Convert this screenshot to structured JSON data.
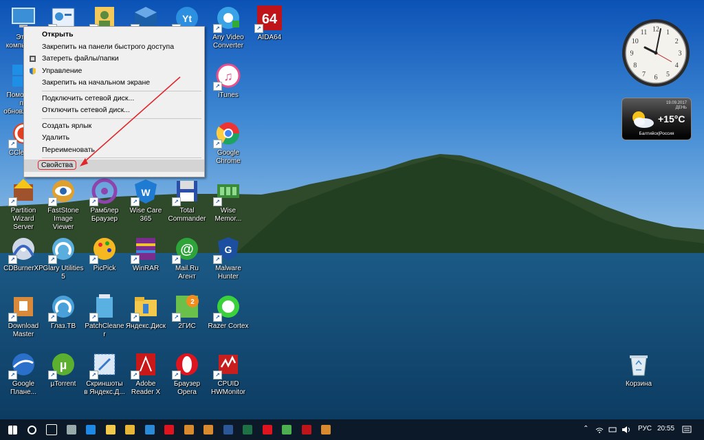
{
  "desktop_icons": [
    {
      "label": "Этот компьютер",
      "kind": "pc"
    },
    {
      "label": "",
      "kind": "panel"
    },
    {
      "label": "",
      "kind": "user"
    },
    {
      "label": "",
      "kind": "vbox"
    },
    {
      "label": "",
      "kind": "yt"
    },
    {
      "label": "Any Video Converter",
      "kind": "avc"
    },
    {
      "label": "AIDA64",
      "kind": "aida"
    },
    {
      "label": "Помощник по обновлению",
      "kind": "win"
    },
    {
      "label": "iTunes",
      "kind": "itunes"
    },
    {
      "label": "CCleaner",
      "kind": "ccleaner"
    },
    {
      "label": "Google Chrome",
      "kind": "chrome"
    },
    {
      "label": "Partition Wizard Server",
      "kind": "partition"
    },
    {
      "label": "FastStone Image Viewer",
      "kind": "faststone"
    },
    {
      "label": "Рамблер Браузер",
      "kind": "rambler"
    },
    {
      "label": "Wise Care 365",
      "kind": "wisecare"
    },
    {
      "label": "Total Commander",
      "kind": "totalcmd"
    },
    {
      "label": "Wise Memor...",
      "kind": "wisemem"
    },
    {
      "label": "CDBurnerXP",
      "kind": "cdburner"
    },
    {
      "label": "Glary Utilities 5",
      "kind": "glary"
    },
    {
      "label": "PicPick",
      "kind": "picpick"
    },
    {
      "label": "WinRAR",
      "kind": "winrar"
    },
    {
      "label": "Mail.Ru Агент",
      "kind": "mailru"
    },
    {
      "label": "Malware Hunter",
      "kind": "malware"
    },
    {
      "label": "Download Master",
      "kind": "dlmaster"
    },
    {
      "label": "Глаз.ТВ",
      "kind": "glaz"
    },
    {
      "label": "PatchCleaner",
      "kind": "patch"
    },
    {
      "label": "Яндекс.Диск",
      "kind": "ydisk"
    },
    {
      "label": "2ГИС",
      "kind": "2gis"
    },
    {
      "label": "Razer Cortex",
      "kind": "razer"
    },
    {
      "label": "Google Плане...",
      "kind": "earth"
    },
    {
      "label": "µTorrent",
      "kind": "utorrent"
    },
    {
      "label": "Скриншоты в Яндекс.Д...",
      "kind": "yscreens"
    },
    {
      "label": "Adobe Reader X",
      "kind": "adobe"
    },
    {
      "label": "Браузер Opera",
      "kind": "opera"
    },
    {
      "label": "CPUID HWMonitor",
      "kind": "cpuid"
    },
    {
      "label": "Корзина",
      "kind": "recycle"
    }
  ],
  "context_menu": {
    "items": [
      {
        "label": "Открыть",
        "bold": true
      },
      {
        "label": "Закрепить на панели быстрого доступа"
      },
      {
        "label": "Затереть файлы/папки",
        "icon": "shredder-icon"
      },
      {
        "label": "Управление",
        "icon": "shield-icon"
      },
      {
        "label": "Закрепить на начальном экране"
      },
      {
        "separator": true
      },
      {
        "label": "Подключить сетевой диск..."
      },
      {
        "label": "Отключить сетевой диск..."
      },
      {
        "separator": true
      },
      {
        "label": "Создать ярлык"
      },
      {
        "label": "Удалить"
      },
      {
        "label": "Переименовать"
      },
      {
        "separator": true
      },
      {
        "label": "Свойства",
        "highlighted": true,
        "circled": true
      }
    ]
  },
  "clock_gadget": {
    "numbers": [
      "1",
      "2",
      "3",
      "4",
      "5",
      "6",
      "7",
      "8",
      "9",
      "10",
      "11",
      "12"
    ]
  },
  "weather_gadget": {
    "date": "19.09.2017",
    "day": "ДЕНЬ",
    "temp": "+15°C",
    "city": "Балтийск|Россия"
  },
  "taskbar": {
    "items": [
      "start-icon",
      "search-icon",
      "task-view-icon",
      "calculator-icon",
      "edge-icon",
      "explorer-icon",
      "folder-icon",
      "ie-icon",
      "yandex-icon",
      "app-icon",
      "app-icon",
      "word-icon",
      "excel-icon",
      "opera-icon",
      "chrome-icon",
      "aida64-icon",
      "app-icon"
    ],
    "tray": {
      "lang": "РУС",
      "time": "20:55"
    }
  },
  "colors": {
    "accent": "#e0262a",
    "taskbar": "#0b1929",
    "menu_bg": "#f0f0f0"
  }
}
